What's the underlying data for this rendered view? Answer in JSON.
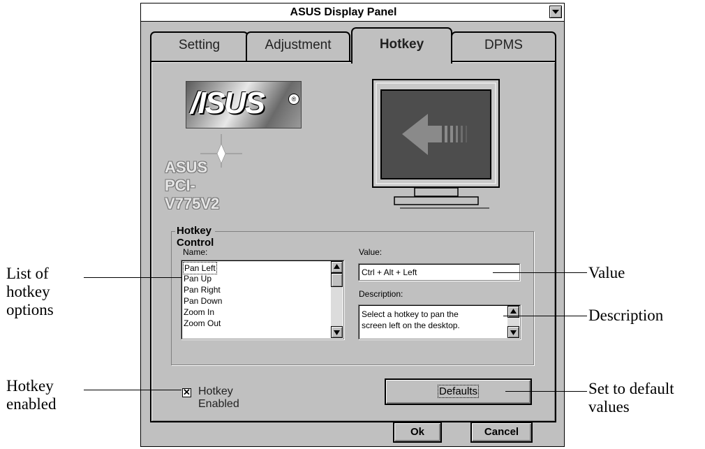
{
  "window": {
    "title": "ASUS Display Panel"
  },
  "tabs": [
    {
      "label": "Setting"
    },
    {
      "label": "Adjustment"
    },
    {
      "label": "Hotkey"
    },
    {
      "label": "DPMS"
    }
  ],
  "logo": {
    "brand": "/ISUS",
    "registered": "®",
    "model": "ASUS PCI-V775V2"
  },
  "hotkey_control": {
    "title": "Hotkey Control",
    "name_label": "Name:",
    "names": [
      "Pan Left",
      "Pan Up",
      "Pan Right",
      "Pan Down",
      "Zoom In",
      "Zoom Out"
    ],
    "selected": "Pan Left",
    "value_label": "Value:",
    "value": "Ctrl + Alt + Left",
    "description_label": "Description:",
    "description_line1": "Select a hotkey to pan the",
    "description_line2": "screen left on the desktop."
  },
  "hotkey_enabled": {
    "label": "Hotkey Enabled",
    "checked": true,
    "mark": "✕"
  },
  "buttons": {
    "defaults": "Defaults",
    "ok": "Ok",
    "cancel": "Cancel"
  },
  "annotations": {
    "list_line1": "List of",
    "list_line2": "hotkey",
    "list_line3": "options",
    "enabled_line1": "Hotkey",
    "enabled_line2": "enabled",
    "value": "Value",
    "description": "Description",
    "defaults_line1": "Set to default",
    "defaults_line2": "values"
  },
  "colors": {
    "face": "#c0c0c0",
    "monitor_screen": "#4d4d4d",
    "arrow": "#8a8a8a"
  }
}
